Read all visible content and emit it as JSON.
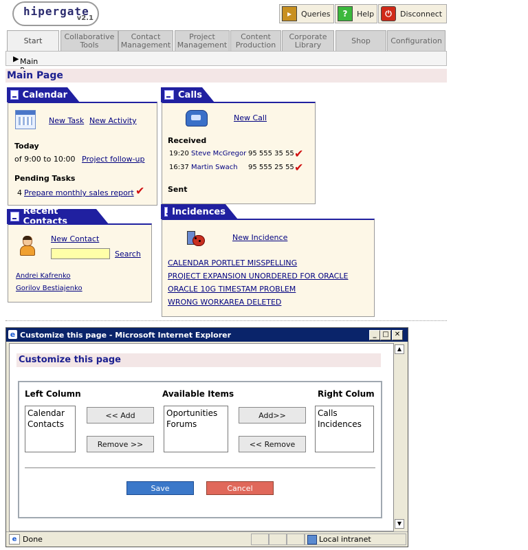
{
  "logo": {
    "name": "hipergate",
    "version": "v2.1"
  },
  "topbar": {
    "queries": "Queries",
    "help": "Help",
    "disconnect": "Disconnect"
  },
  "tabs": [
    "Start",
    "Collaborative Tools",
    "Contact Management",
    "Project Management",
    "Content Production",
    "Corporate Library",
    "Shop",
    "Configuration"
  ],
  "breadcrumb": "Main Page",
  "page_title": "Main Page",
  "calendar": {
    "title": "Calendar",
    "new_task": "New Task",
    "new_activity": "New Activity",
    "today_label": "Today",
    "today_time": "of 9:00 to 10:00",
    "today_event": "Project follow-up",
    "pending_label": "Pending Tasks",
    "pending_num": "4",
    "pending_task": "Prepare monthly sales report"
  },
  "contacts": {
    "title": "Recent Contacts",
    "new_contact": "New Contact",
    "search_value": "",
    "search": "Search",
    "items": [
      "Andrei Kafrenko",
      "Gorilov Bestiajenko"
    ]
  },
  "calls": {
    "title": "Calls",
    "new_call": "New Call",
    "received_label": "Received",
    "received": [
      {
        "time": "19:20",
        "name": "Steve McGregor",
        "phone": "95 555 35 55"
      },
      {
        "time": "16:37",
        "name": "Martin Swach",
        "phone": "95 555 25 55"
      }
    ],
    "sent_label": "Sent"
  },
  "incidences": {
    "title": "Incidences",
    "new_incidence": "New Incidence",
    "items": [
      "CALENDAR PORTLET MISSPELLING",
      "PROJECT EXPANSION UNORDERED FOR ORACLE",
      "ORACLE 10G TIMESTAM PROBLEM",
      "WRONG WORKAREA DELETED"
    ]
  },
  "popup": {
    "window_title": "Customize this page - Microsoft Internet Explorer",
    "heading": "Customize this page",
    "left_label": "Left Column",
    "left_items": [
      "Calendar",
      "Contacts"
    ],
    "available_label": "Available Items",
    "available_items": [
      "Oportunities",
      "Forums"
    ],
    "right_label": "Right Colum",
    "right_items": [
      "Calls",
      "Incidences"
    ],
    "add_left": "<< Add",
    "remove_left": "Remove >>",
    "add_right": "Add>>",
    "remove_right": "<< Remove",
    "save": "Save",
    "cancel": "Cancel",
    "status_done": "Done",
    "status_zone": "Local intranet"
  },
  "colors": {
    "portlet_header": "#2020a0",
    "portlet_bg": "#fdf7e7",
    "title_bar": "#0a246a",
    "save_btn": "#3b78c9",
    "cancel_btn": "#e0685a"
  },
  "icons": [
    "queries-icon",
    "help-icon",
    "disconnect-icon",
    "calendar-icon",
    "contact-icon",
    "phone-icon",
    "bug-icon",
    "checkmark-icon",
    "ie-icon"
  ]
}
